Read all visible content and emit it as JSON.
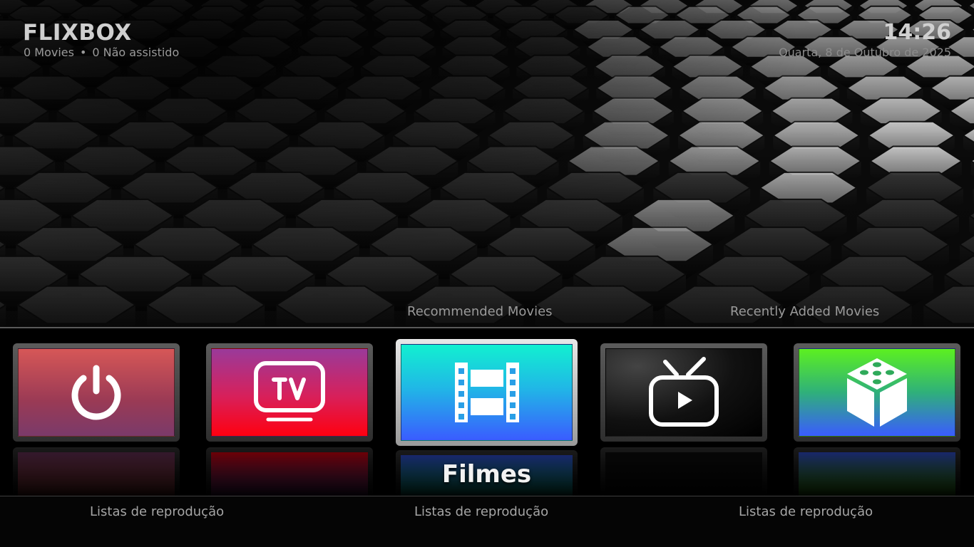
{
  "header": {
    "brand": "FLIXBOX",
    "movies_count": "0 Movies",
    "separator": "•",
    "unwatched_count": "0 Não assistido",
    "clock": "14:26",
    "date": "Quarta, 8 de Outubro de 2025"
  },
  "widgets": {
    "recommended": "Recommended Movies",
    "recent": "Recently Added Movies"
  },
  "menu": {
    "focused_label": "Filmes",
    "items": [
      {
        "id": "power",
        "icon": "power-icon",
        "color": "#d65757"
      },
      {
        "id": "tv",
        "icon": "tv-icon",
        "color": "#ff0010"
      },
      {
        "id": "movies",
        "icon": "film-strip-icon",
        "color": "#12f0d0",
        "focused": true
      },
      {
        "id": "livetv",
        "icon": "live-tv-icon",
        "color": "#111111"
      },
      {
        "id": "games",
        "icon": "dice-cube-icon",
        "color": "#5cf020"
      }
    ]
  },
  "submenu": {
    "left": "Listas de reprodução",
    "center": "Listas de reprodução",
    "right": "Listas de reprodução"
  }
}
